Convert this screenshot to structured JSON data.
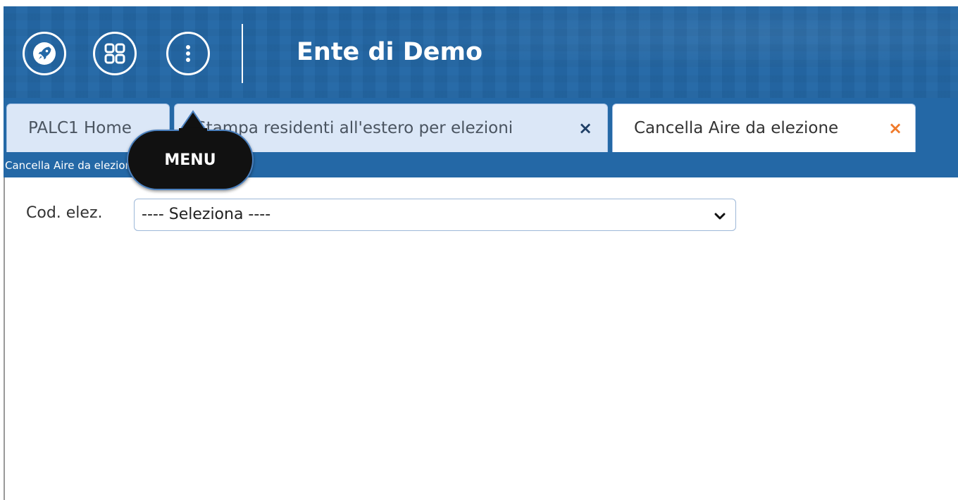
{
  "header": {
    "title": "Ente di Demo",
    "buttons": [
      {
        "icon": "rocket-icon"
      },
      {
        "icon": "apps-grid-icon"
      },
      {
        "icon": "more-vertical-icon"
      }
    ],
    "background_color": "#2468a6"
  },
  "tabs": [
    {
      "label": "PALC1 Home",
      "closable": false,
      "active": false
    },
    {
      "label": "Stampa residenti all'estero per elezioni",
      "closable": true,
      "close_glyph": "×",
      "active": false
    },
    {
      "label": "Cancella Aire da elezione",
      "closable": true,
      "close_glyph": "×",
      "active": true
    }
  ],
  "tab_close_colors": {
    "inactive": "#1f3f66",
    "active": "#f07a2a"
  },
  "breadcrumb": "Cancella Aire da elezione",
  "tooltip": {
    "text": "MENU"
  },
  "form": {
    "field_label": "Cod. elez.",
    "select_value": "---- Seleziona ----"
  }
}
